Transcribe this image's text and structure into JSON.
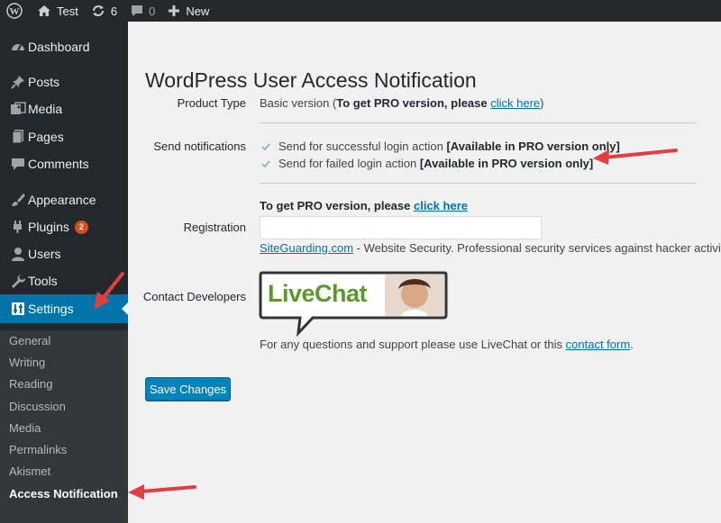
{
  "adminbar": {
    "site_name": "Test",
    "updates_count": "6",
    "comments_count": "0",
    "new_label": "New"
  },
  "sidebar": {
    "items": [
      {
        "label": "Dashboard",
        "icon": "dashboard-icon"
      },
      {
        "label": "Posts",
        "icon": "pin-icon"
      },
      {
        "label": "Media",
        "icon": "media-icon"
      },
      {
        "label": "Pages",
        "icon": "pages-icon"
      },
      {
        "label": "Comments",
        "icon": "comment-icon"
      },
      {
        "label": "Appearance",
        "icon": "brush-icon"
      },
      {
        "label": "Plugins",
        "icon": "plugin-icon",
        "badge": "2"
      },
      {
        "label": "Users",
        "icon": "user-icon"
      },
      {
        "label": "Tools",
        "icon": "wrench-icon"
      },
      {
        "label": "Settings",
        "icon": "settings-icon"
      }
    ],
    "submenu": [
      "General",
      "Writing",
      "Reading",
      "Discussion",
      "Media",
      "Permalinks",
      "Akismet",
      "Access Notification"
    ]
  },
  "main": {
    "title": "WordPress User Access Notification",
    "product_type": {
      "label": "Product Type",
      "value_prefix": "Basic version (",
      "value_bold": "To get PRO version, please",
      "link": "click here",
      "value_suffix": ")"
    },
    "notifications": {
      "label": "Send notifications",
      "options": [
        {
          "text": "Send for successful login action",
          "note": "[Available in PRO version only]",
          "checked": true
        },
        {
          "text": "Send for failed login action",
          "note": "[Available in PRO version only]",
          "checked": true
        }
      ]
    },
    "registration": {
      "label": "Registration",
      "intro_bold": "To get PRO version, please",
      "intro_link": "click here",
      "input_value": "",
      "site_link": "SiteGuarding.com",
      "site_desc": " - Website Security. Professional security services against hacker activity."
    },
    "contact": {
      "label": "Contact Developers",
      "banner_text": "LiveChat",
      "support_text": "For any questions and support please use LiveChat or this ",
      "support_link": "contact form",
      "support_suffix": "."
    },
    "save_label": "Save Changes"
  },
  "colors": {
    "sidebar_bg": "#23282d",
    "submenu_bg": "#32373c",
    "accent": "#0073aa",
    "button": "#0085ba",
    "badge": "#d54e21",
    "annotation_arrow": "#e04040"
  }
}
